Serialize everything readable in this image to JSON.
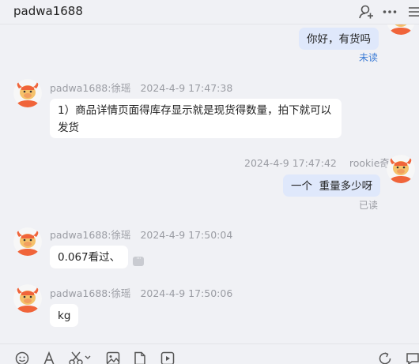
{
  "header": {
    "title": "padwa1688",
    "icons": [
      "add-user-icon",
      "more-icon",
      "menu-icon"
    ]
  },
  "messages": [
    {
      "direction": "out",
      "text": "你好，有货吗",
      "status": "未读"
    },
    {
      "direction": "in",
      "sender": "padwa1688:徐瑶",
      "time": "2024-4-9 17:47:38",
      "text": "1）商品详情页面得库存显示就是现货得数量，拍下就可以发货"
    },
    {
      "direction": "out",
      "sender": "rookie奇",
      "time": "2024-4-9 17:47:42",
      "text": "一个  重量多少呀",
      "status": "已读"
    },
    {
      "direction": "in",
      "sender": "padwa1688:徐瑶",
      "time": "2024-4-9 17:50:04",
      "text": "0.067看过、"
    },
    {
      "direction": "in",
      "sender": "padwa1688:徐瑶",
      "time": "2024-4-9 17:50:06",
      "text": "kg"
    }
  ],
  "toolbar": {
    "icons": [
      "emoji-icon",
      "font-icon",
      "scissors-icon",
      "image-icon",
      "file-icon",
      "video-icon",
      "quick-reply-icon",
      "chat-icon"
    ]
  },
  "colors": {
    "background": "#f0f1f5",
    "incoming_bubble": "#ffffff",
    "outgoing_bubble": "#dfe8fb",
    "unread": "#3a7bd5",
    "avatar": "#f0643a"
  }
}
